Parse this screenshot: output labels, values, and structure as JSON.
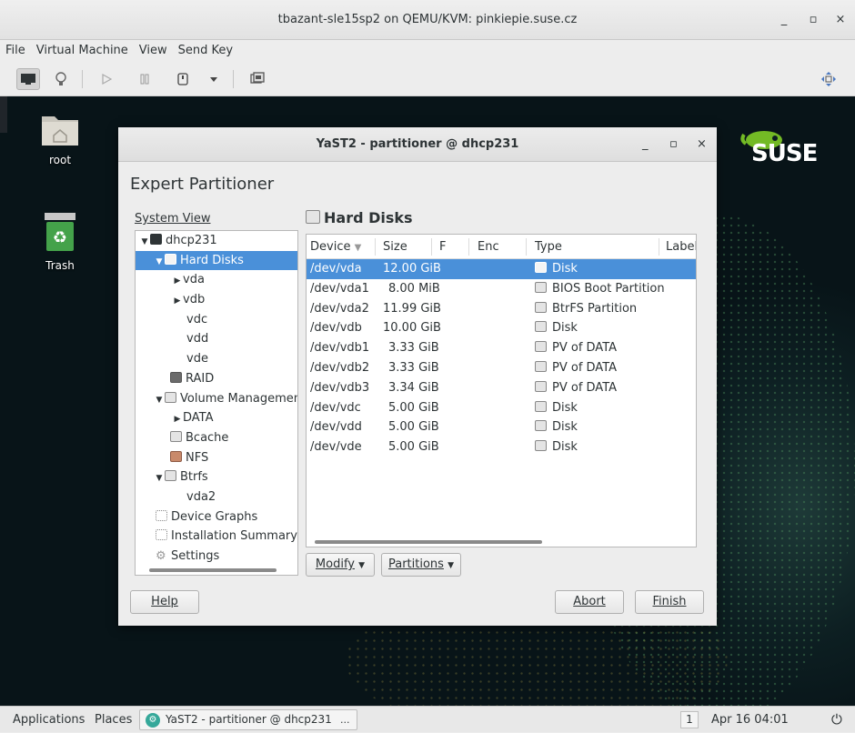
{
  "window": {
    "title": "tbazant-sle15sp2 on QEMU/KVM: pinkiepie.suse.cz",
    "minimize": "_",
    "maximize": "▫",
    "close": "×"
  },
  "menubar": [
    "File",
    "Virtual Machine",
    "View",
    "Send Key"
  ],
  "toolbar": {
    "icons": [
      "monitor-icon",
      "lightbulb-icon",
      "play-icon",
      "pause-icon",
      "power-icon",
      "dropdown-icon",
      "screenshot-icon",
      "resize-icon"
    ]
  },
  "desktop": {
    "icons": [
      {
        "label": "root",
        "icon": "home-folder-icon"
      },
      {
        "label": "Trash",
        "icon": "trash-icon"
      }
    ],
    "logo": "SUSE"
  },
  "yast": {
    "title": "YaST2 - partitioner @ dhcp231",
    "heading": "Expert Partitioner",
    "system_view_label": "System View",
    "tree": [
      {
        "label": "dhcp231",
        "depth": 0,
        "expander": "down",
        "icon": "computer-icon"
      },
      {
        "label": "Hard Disks",
        "depth": 1,
        "expander": "down",
        "icon": "disk-icon",
        "selected": true
      },
      {
        "label": "vda",
        "depth": 2,
        "expander": "right"
      },
      {
        "label": "vdb",
        "depth": 2,
        "expander": "right"
      },
      {
        "label": "vdc",
        "depth": 2
      },
      {
        "label": "vdd",
        "depth": 2
      },
      {
        "label": "vde",
        "depth": 2
      },
      {
        "label": "RAID",
        "depth": 1,
        "icon": "raid-icon"
      },
      {
        "label": "Volume Management",
        "depth": 1,
        "expander": "down",
        "icon": "lvm-icon"
      },
      {
        "label": "DATA",
        "depth": 2,
        "expander": "right"
      },
      {
        "label": "Bcache",
        "depth": 1,
        "icon": "bcache-icon"
      },
      {
        "label": "NFS",
        "depth": 1,
        "icon": "nfs-icon"
      },
      {
        "label": "Btrfs",
        "depth": 1,
        "expander": "down",
        "icon": "btrfs-icon"
      },
      {
        "label": "vda2",
        "depth": 2
      },
      {
        "label": "Device Graphs",
        "depth": 0,
        "icon": "graph-icon"
      },
      {
        "label": "Installation Summary",
        "depth": 0,
        "icon": "summary-icon"
      },
      {
        "label": "Settings",
        "depth": 0,
        "icon": "settings-icon"
      }
    ],
    "panel_title": "Hard Disks",
    "columns": [
      "Device",
      "Size",
      "F",
      "Enc",
      "Type",
      "Label"
    ],
    "rows": [
      {
        "device": "/dev/vda",
        "size": "12.00 GiB",
        "type": "Disk",
        "selected": true
      },
      {
        "device": "/dev/vda1",
        "size": "8.00 MiB",
        "type": "BIOS Boot Partition"
      },
      {
        "device": "/dev/vda2",
        "size": "11.99 GiB",
        "type": "BtrFS Partition"
      },
      {
        "device": "/dev/vdb",
        "size": "10.00 GiB",
        "type": "Disk"
      },
      {
        "device": "/dev/vdb1",
        "size": "3.33 GiB",
        "type": "PV of DATA"
      },
      {
        "device": "/dev/vdb2",
        "size": "3.33 GiB",
        "type": "PV of DATA"
      },
      {
        "device": "/dev/vdb3",
        "size": "3.34 GiB",
        "type": "PV of DATA"
      },
      {
        "device": "/dev/vdc",
        "size": "5.00 GiB",
        "type": "Disk"
      },
      {
        "device": "/dev/vdd",
        "size": "5.00 GiB",
        "type": "Disk"
      },
      {
        "device": "/dev/vde",
        "size": "5.00 GiB",
        "type": "Disk"
      }
    ],
    "buttons": {
      "modify": "Modify",
      "partitions": "Partitions",
      "help": "Help",
      "abort": "Abort",
      "finish": "Finish"
    }
  },
  "taskbar": {
    "applications": "Applications",
    "places": "Places",
    "task": "YaST2 - partitioner @ dhcp231",
    "task_more": "...",
    "workspace": "1",
    "clock": "Apr 16 04:01"
  },
  "colors": {
    "selection": "#4a90d9",
    "suse_green": "#73ba25",
    "desktop_bg": "#0d1f22"
  }
}
